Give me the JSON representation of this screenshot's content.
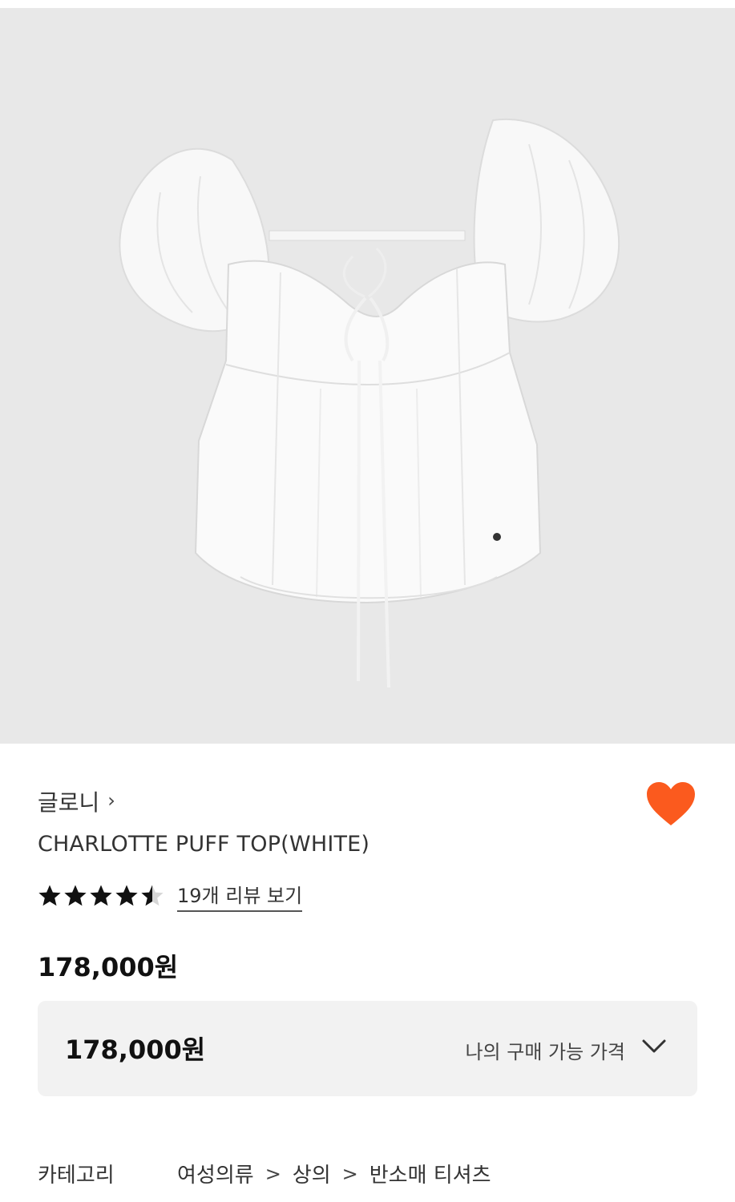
{
  "product_image": {
    "alt": "white puff sleeve top",
    "background": "#e8e8e8"
  },
  "brand": {
    "name": "글로니",
    "chevron": "›"
  },
  "product": {
    "name": "CHARLOTTE PUFF TOP(WHITE)"
  },
  "rating": {
    "stars_value": 4.5,
    "stars_max": 5,
    "review_link": "19개 리뷰 보기"
  },
  "price": {
    "main": "178,000원",
    "box_value": "178,000원",
    "box_label": "나의 구매 가능 가격"
  },
  "wishlist": {
    "icon": "heart-icon",
    "color": "#fb5a1e",
    "active": true
  },
  "category": {
    "label": "카테고리",
    "path": [
      "여성의류",
      "상의",
      "반소매 티셔츠"
    ],
    "separator": ">"
  }
}
